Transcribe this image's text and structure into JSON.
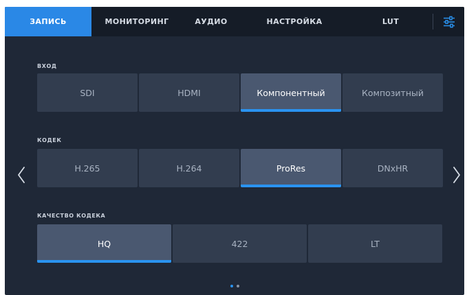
{
  "tabs": [
    {
      "label": "ЗАПИСЬ",
      "active": true
    },
    {
      "label": "МОНИТОРИНГ",
      "active": false
    },
    {
      "label": "АУДИО",
      "active": false
    },
    {
      "label": "НАСТРОЙКА",
      "active": false
    },
    {
      "label": "LUT",
      "active": false
    }
  ],
  "input": {
    "label": "ВХОД",
    "options": [
      "SDI",
      "HDMI",
      "Компонентный",
      "Композитный"
    ],
    "selected": "Компонентный"
  },
  "codec": {
    "label": "КОДЕК",
    "options": [
      "H.265",
      "H.264",
      "ProRes",
      "DNxHR"
    ],
    "selected": "ProRes"
  },
  "quality": {
    "label": "КАЧЕСТВО КОДЕКА",
    "options": [
      "HQ",
      "422",
      "LT"
    ],
    "selected": "HQ"
  },
  "pagination": {
    "current": 1,
    "total": 2
  },
  "colors": {
    "accent": "#2a88e6",
    "background": "#1f2837",
    "tabbar": "#151c27",
    "button": "#323d4f",
    "button_selected": "#4a5870"
  },
  "icons": {
    "settings": "sliders-icon",
    "prev": "chevron-left-icon",
    "next": "chevron-right-icon"
  }
}
